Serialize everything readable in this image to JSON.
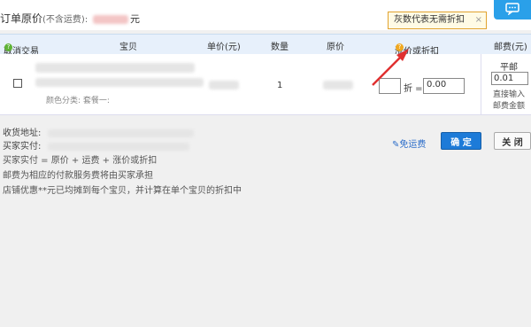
{
  "header": {
    "title_prefix": "订单原价",
    "title_note": "(不含运费):",
    "title_unit": "元",
    "tooltip_text": "灰数代表无需折扣",
    "tooltip_close": "×"
  },
  "table": {
    "columns": {
      "cancel": "取消交易",
      "item": "宝贝",
      "unit_price": "单价(元)",
      "quantity": "数量",
      "original_price": "原价",
      "discount": "涨价或折扣",
      "shipping": "邮费(元)"
    },
    "row": {
      "spec_label": "颜色分类: 套餐一:",
      "quantity": "1",
      "discount_text": "折 =",
      "discount_value": "0.00",
      "shipping_mode": "平邮",
      "shipping_value": "0.01",
      "shipping_note1": "直接输入",
      "shipping_note2": "邮费金额"
    }
  },
  "info": {
    "address_label": "收货地址:",
    "payment_label": "买家实付:",
    "formula": "买家实付 = 原价 + 运费 + 涨价或折扣",
    "note1": "邮费为相应的付款服务费将由买家承担",
    "note2": "店铺优惠**元已均摊到每个宝贝，并计算在单个宝贝的折扣中"
  },
  "actions": {
    "free_shipping": "免运费",
    "confirm": "确 定",
    "close": "关 闭"
  },
  "colors": {
    "header_bg": "#e7f0fb",
    "primary_button": "#1d7bd8",
    "arrow": "#e03030",
    "tooltip_border": "#e1a32e"
  }
}
